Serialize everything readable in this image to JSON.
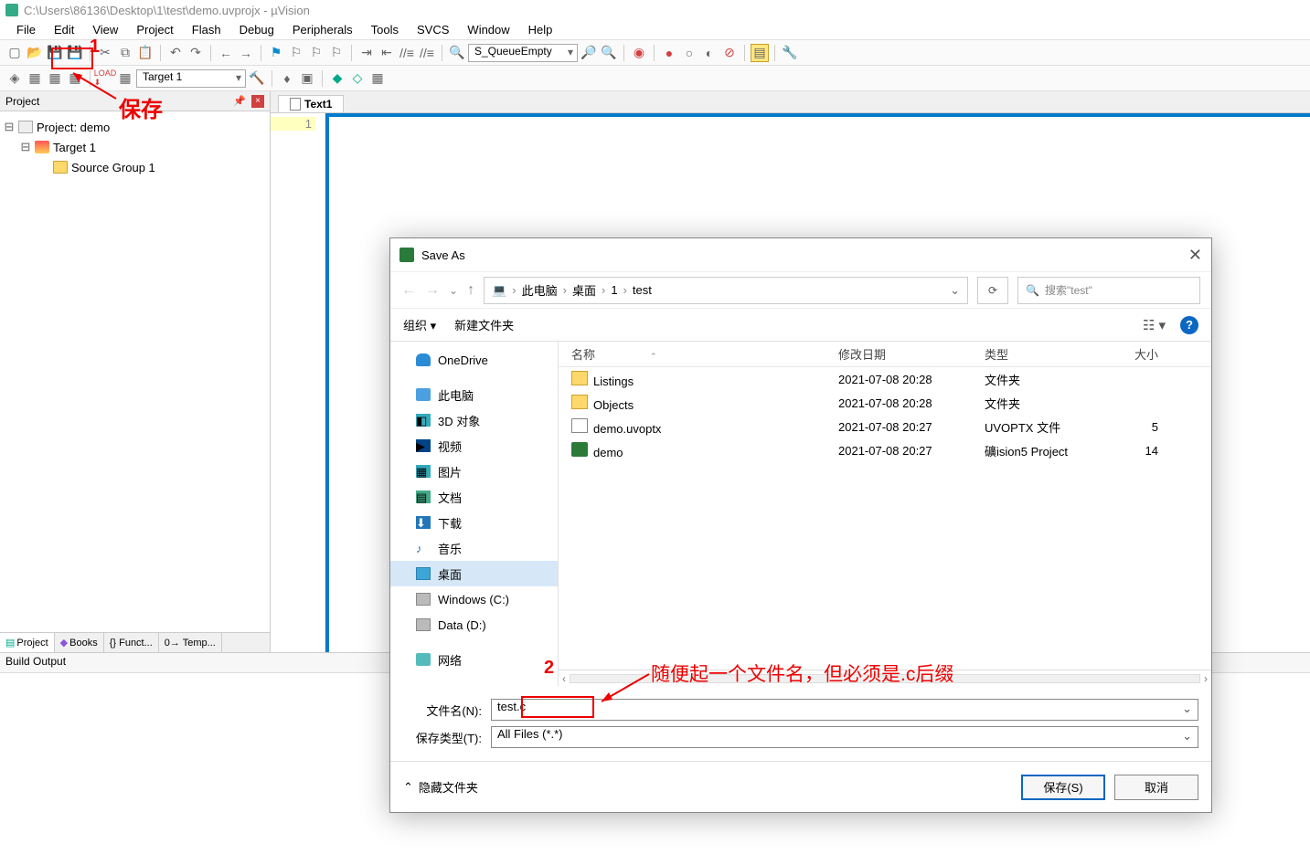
{
  "title": "C:\\Users\\86136\\Desktop\\1\\test\\demo.uvprojx - µVision",
  "menu": [
    "File",
    "Edit",
    "View",
    "Project",
    "Flash",
    "Debug",
    "Peripherals",
    "Tools",
    "SVCS",
    "Window",
    "Help"
  ],
  "toolbar1": {
    "combo": "S_QueueEmpty"
  },
  "toolbar2": {
    "target_combo": "Target 1"
  },
  "project_panel": {
    "title": "Project",
    "root": "Project: demo",
    "target": "Target 1",
    "group": "Source Group 1",
    "tabs": [
      "Project",
      "Books",
      "{} Funct...",
      "0→ Temp..."
    ]
  },
  "editor": {
    "tab": "Text1",
    "line_no": "1"
  },
  "build_output": {
    "title": "Build Output"
  },
  "annotations": {
    "num1": "1",
    "save_label": "保存",
    "num2": "2",
    "hint": "随便起一个文件名，但必须是.c后缀"
  },
  "dialog": {
    "title": "Save As",
    "crumbs": [
      "此电脑",
      "桌面",
      "1",
      "test"
    ],
    "search_placeholder": "搜索\"test\"",
    "organize": "组织",
    "new_folder": "新建文件夹",
    "nav_items": [
      "OneDrive",
      "此电脑",
      "3D 对象",
      "视频",
      "图片",
      "文档",
      "下载",
      "音乐",
      "桌面",
      "Windows (C:)",
      "Data (D:)",
      "网络"
    ],
    "columns": {
      "name": "名称",
      "date": "修改日期",
      "type": "类型",
      "size": "大小"
    },
    "files": [
      {
        "icon": "folder",
        "name": "Listings",
        "date": "2021-07-08 20:28",
        "type": "文件夹",
        "size": ""
      },
      {
        "icon": "folder",
        "name": "Objects",
        "date": "2021-07-08 20:28",
        "type": "文件夹",
        "size": ""
      },
      {
        "icon": "doc",
        "name": "demo.uvoptx",
        "date": "2021-07-08 20:27",
        "type": "UVOPTX 文件",
        "size": "5"
      },
      {
        "icon": "proj",
        "name": "demo",
        "date": "2021-07-08 20:27",
        "type": "礦ision5 Project",
        "size": "14"
      }
    ],
    "filename_label": "文件名(N):",
    "filename_value": "test.c",
    "filetype_label": "保存类型(T):",
    "filetype_value": "All Files (*.*)",
    "hide_folders": "隐藏文件夹",
    "save_btn": "保存(S)",
    "cancel_btn": "取消"
  }
}
